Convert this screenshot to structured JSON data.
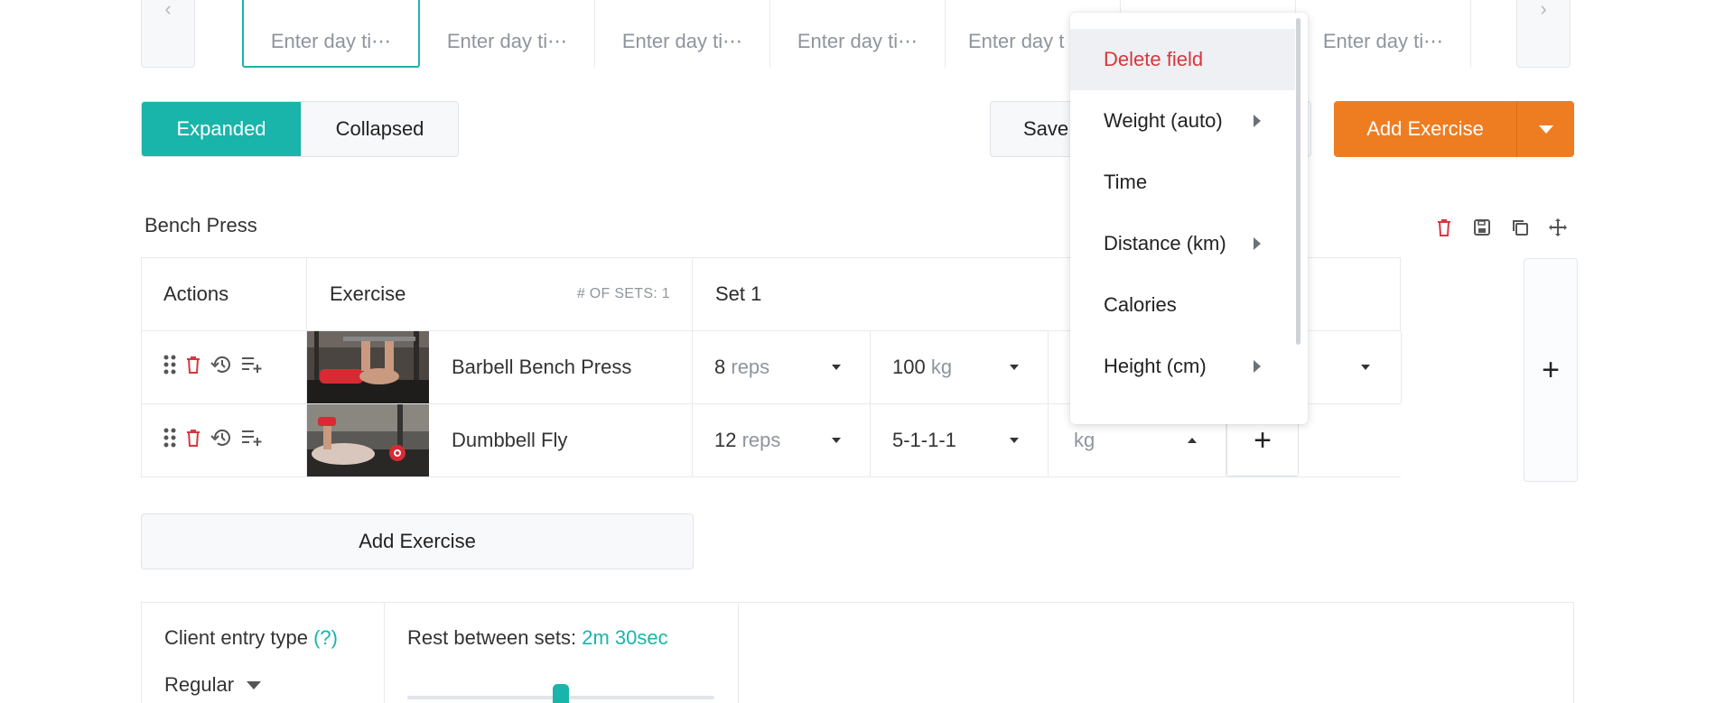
{
  "day_tabs": {
    "placeholder": "Enter day ti⋯",
    "items": [
      {
        "label": "Enter day ti⋯"
      },
      {
        "label": "Enter day ti⋯"
      },
      {
        "label": "Enter day ti⋯"
      },
      {
        "label": "Enter day ti⋯"
      },
      {
        "label": "Enter day t"
      },
      {
        "label": ""
      },
      {
        "label": "Enter day ti⋯"
      }
    ],
    "prev_icon": "chevron-left-icon",
    "next_icon": "chevron-right-icon"
  },
  "view_toggle": {
    "expanded_label": "Expanded",
    "collapsed_label": "Collapsed",
    "selected": "Expanded"
  },
  "toolbar": {
    "save_label": "Save",
    "add_exercise_label": "Add Exercise"
  },
  "block": {
    "title": "Bench Press",
    "tools": [
      "trash-icon",
      "save-icon",
      "copy-icon",
      "move-icon"
    ]
  },
  "table": {
    "headers": {
      "actions": "Actions",
      "exercise": "Exercise",
      "sets_count": "# OF SETS: 1",
      "set": "Set 1"
    },
    "rows": [
      {
        "name": "Barbell Bench Press",
        "reps_value": "8",
        "reps_unit": "reps",
        "weight_value": "100",
        "weight_unit": "kg"
      },
      {
        "name": "Dumbbell Fly",
        "reps_value": "12",
        "reps_unit": "reps",
        "tempo_value": "5-1-1-1",
        "weight_placeholder": "kg"
      }
    ],
    "plus_symbol": "+"
  },
  "add_exercise_bottom": "Add Exercise",
  "client_entry": {
    "label": "Client entry type",
    "help": "(?)",
    "value": "Regular"
  },
  "rest": {
    "label": "Rest between sets:",
    "value": "2m 30sec",
    "slider_fraction": 0.5
  },
  "context_menu": {
    "items": [
      {
        "label": "Delete field",
        "danger": true,
        "submenu": false
      },
      {
        "label": "Weight (auto)",
        "danger": false,
        "submenu": true
      },
      {
        "label": "Time",
        "danger": false,
        "submenu": false
      },
      {
        "label": "Distance (km)",
        "danger": false,
        "submenu": true
      },
      {
        "label": "Calories",
        "danger": false,
        "submenu": false
      },
      {
        "label": "Height (cm)",
        "danger": false,
        "submenu": true
      }
    ]
  },
  "colors": {
    "accent": "#19b5aa",
    "orange": "#ee7d22",
    "danger": "#d9363e"
  }
}
